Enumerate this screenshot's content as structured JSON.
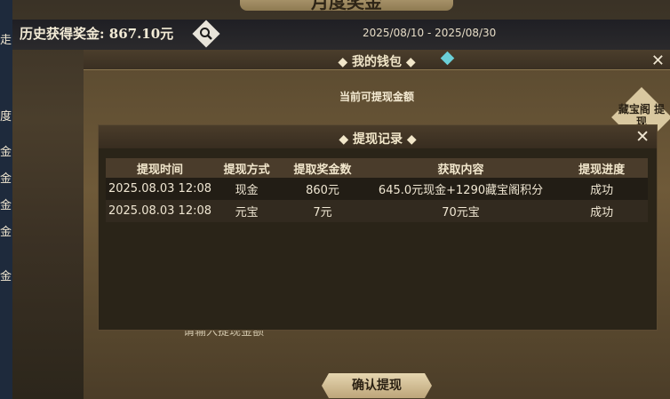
{
  "header": {
    "title": "月度奖金",
    "history_label": "历史获得奖金: 867.10元",
    "date_range": "2025/08/10 - 2025/08/30"
  },
  "left_menu": [
    "走",
    "度",
    "金",
    "金",
    "金",
    "金",
    "金"
  ],
  "wallet": {
    "title": "◆ 我的钱包 ◆",
    "current_label": "当前可提现金额",
    "side_badge": "藏宝阁\n提现",
    "confirm_label": "确认提现",
    "input_hint": "请输入提现金额"
  },
  "records": {
    "title": "◆ 提现记录 ◆",
    "columns": [
      "提现时间",
      "提现方式",
      "提取奖金数",
      "获取内容",
      "提现进度"
    ],
    "rows": [
      [
        "2025.08.03  12:08",
        "现金",
        "860元",
        "645.0元现金+1290藏宝阁积分",
        "成功"
      ],
      [
        "2025.08.03  12:08",
        "元宝",
        "7元",
        "70元宝",
        "成功"
      ]
    ]
  },
  "icons": {
    "search": "search-icon",
    "close": "close-icon",
    "gem": "gem-icon"
  },
  "colors": {
    "accent": "#c9b489",
    "panel": "#2a2418",
    "header": "#4a3c2b"
  }
}
